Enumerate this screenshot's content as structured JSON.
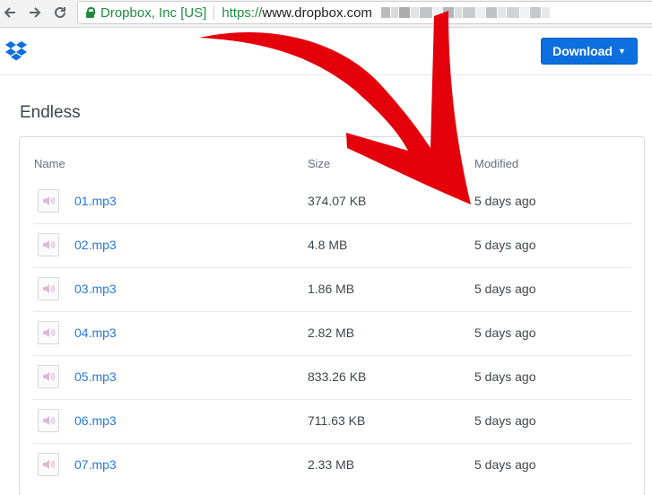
{
  "browser": {
    "org": "Dropbox, Inc [US]",
    "url_scheme": "https://",
    "url_host": "www.dropbox.com"
  },
  "header": {
    "download_label": "Download",
    "download_caret": "▼"
  },
  "folder": {
    "title": "Endless"
  },
  "table": {
    "columns": {
      "name": "Name",
      "size": "Size",
      "modified": "Modified"
    },
    "rows": [
      {
        "name": "01.mp3",
        "size": "374.07 KB",
        "modified": "5 days ago"
      },
      {
        "name": "02.mp3",
        "size": "4.8 MB",
        "modified": "5 days ago"
      },
      {
        "name": "03.mp3",
        "size": "1.86 MB",
        "modified": "5 days ago"
      },
      {
        "name": "04.mp3",
        "size": "2.82 MB",
        "modified": "5 days ago"
      },
      {
        "name": "05.mp3",
        "size": "833.26 KB",
        "modified": "5 days ago"
      },
      {
        "name": "06.mp3",
        "size": "711.63 KB",
        "modified": "5 days ago"
      },
      {
        "name": "07.mp3",
        "size": "2.33 MB",
        "modified": "5 days ago"
      }
    ]
  },
  "colors": {
    "brand_blue": "#0d6ee0",
    "link_blue": "#2a78d6",
    "secure_green": "#1e8e3e",
    "annotation_red": "#e3000b"
  },
  "icons": {
    "back": "back-arrow-icon",
    "forward": "forward-arrow-icon",
    "reload": "reload-icon",
    "lock": "lock-icon",
    "logo": "dropbox-logo-icon",
    "file": "audio-file-icon",
    "annotation": "red-arrow-annotation"
  }
}
